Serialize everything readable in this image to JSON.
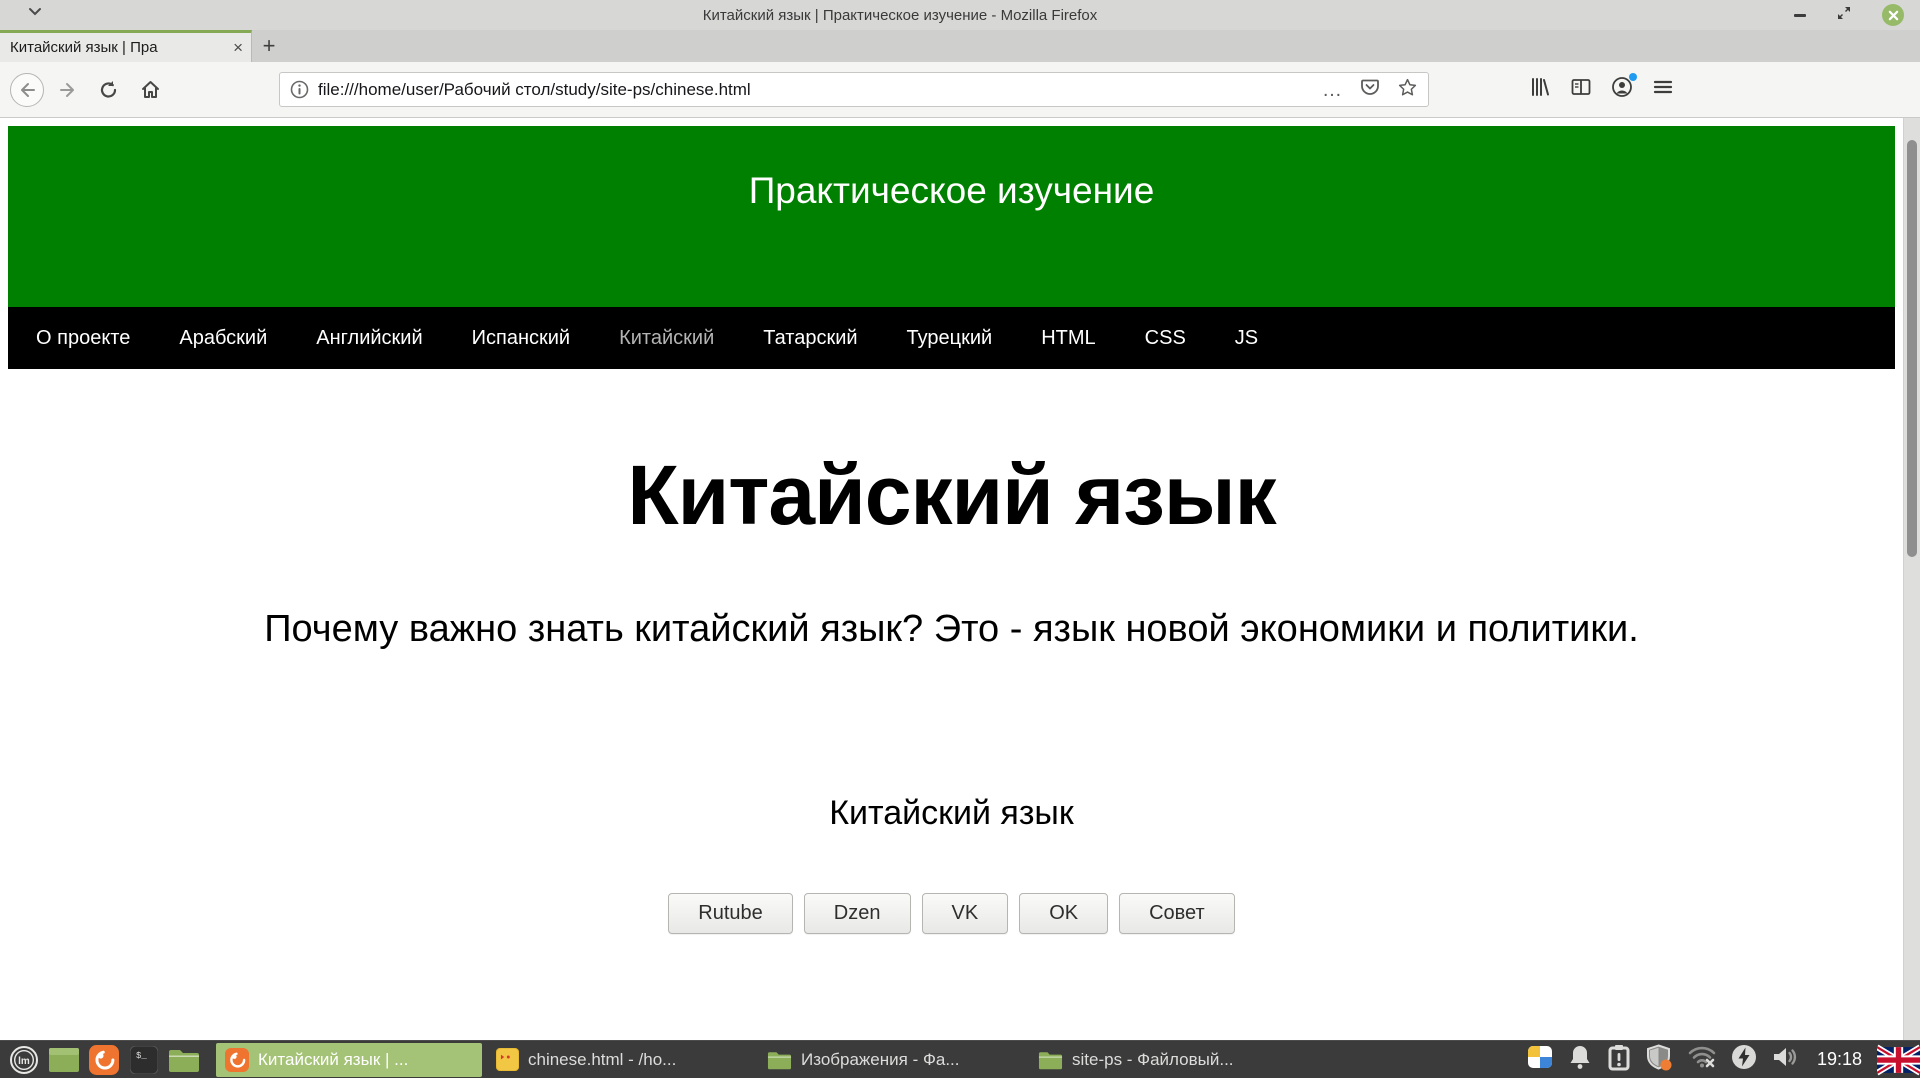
{
  "titlebar": {
    "title": "Китайский язык | Практическое изучение - Mozilla Firefox"
  },
  "tabs": {
    "active_title": "Китайский язык | Пра",
    "close_glyph": "×",
    "new_tab_glyph": "+"
  },
  "urlbar": {
    "url": "file:///home/user/Рабочий стол/study/site-ps/chinese.html",
    "page_actions_glyph": "…"
  },
  "page": {
    "banner_title": "Практическое изучение",
    "nav_items": [
      {
        "label": "О проекте"
      },
      {
        "label": "Арабский"
      },
      {
        "label": "Английский"
      },
      {
        "label": "Испанский"
      },
      {
        "label": "Китайский"
      },
      {
        "label": "Татарский"
      },
      {
        "label": "Турецкий"
      },
      {
        "label": "HTML"
      },
      {
        "label": "CSS"
      },
      {
        "label": "JS"
      }
    ],
    "heading": "Китайский язык",
    "intro": "Почему важно знать китайский язык? Это - язык новой экономики и политики.",
    "subheading": "Китайский язык",
    "buttons": [
      "Rutube",
      "Dzen",
      "VK",
      "OK",
      "Совет"
    ]
  },
  "taskbar": {
    "tasks": [
      {
        "title": "Китайский язык | ..."
      },
      {
        "title": "chinese.html - /ho..."
      },
      {
        "title": "Изображения - Фа..."
      },
      {
        "title": "site-ps - Файловый..."
      }
    ],
    "clock": "19:18"
  },
  "colors": {
    "banner_green": "#008000",
    "nav_black": "#000000",
    "accent_tab_green": "#85a954",
    "taskbar_active_green": "#a4c377",
    "close_button_green": "#96ba68"
  }
}
